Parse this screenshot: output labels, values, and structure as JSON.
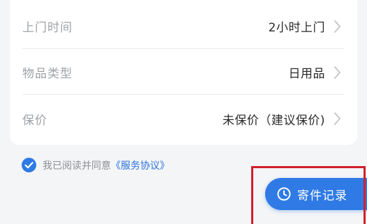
{
  "form": {
    "rows": [
      {
        "label": "上门时间",
        "value": "2小时上门"
      },
      {
        "label": "物品类型",
        "value": "日用品"
      },
      {
        "label": "保价",
        "value": "未保价（建议保价)"
      }
    ]
  },
  "agreement": {
    "checked": true,
    "text": "我已阅读并同意",
    "link": "《服务协议》"
  },
  "records_button": {
    "label": "寄件记录",
    "icon": "clock-icon"
  },
  "colors": {
    "accent": "#2f7ae5",
    "highlight": "#d21e2b",
    "label_gray": "#9ea1a6",
    "value_dark": "#2a2a2a"
  }
}
